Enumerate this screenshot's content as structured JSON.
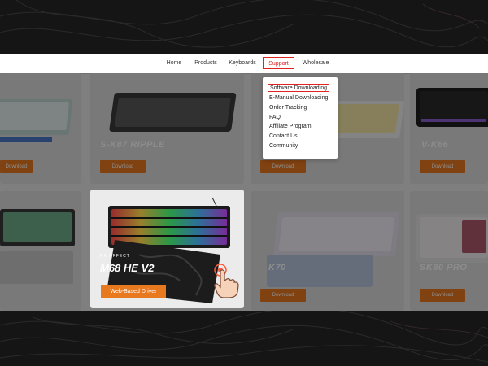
{
  "colors": {
    "accent_red": "#e02222",
    "download_orange": "#e9791f",
    "page_bg": "#151515"
  },
  "nav": {
    "items": [
      {
        "label": "Home",
        "active": false
      },
      {
        "label": "Products",
        "active": false
      },
      {
        "label": "Keyboards",
        "active": false
      },
      {
        "label": "Support",
        "active": true
      },
      {
        "label": "Wholesale",
        "active": false
      }
    ]
  },
  "support_menu": {
    "items": [
      {
        "label": "Software Downloading",
        "active": true
      },
      {
        "label": "E-Manual Downloading",
        "active": false
      },
      {
        "label": "Order Tracking",
        "active": false
      },
      {
        "label": "FAQ",
        "active": false
      },
      {
        "label": "Affiliate Program",
        "active": false
      },
      {
        "label": "Contact Us",
        "active": false
      },
      {
        "label": "Community",
        "active": false
      }
    ]
  },
  "products": {
    "row1": [
      {
        "name": "",
        "button": "Download"
      },
      {
        "name": "S-K87 RIPPLE",
        "button": "Download"
      },
      {
        "name": "",
        "button": "Download"
      },
      {
        "name": "V-K66",
        "button": "Download"
      }
    ],
    "row2": [
      {
        "name": "",
        "button": ""
      },
      {
        "name": "",
        "button": ""
      },
      {
        "name": "K70",
        "button": "Download"
      },
      {
        "name": "SK80 PRO",
        "button": "Download"
      }
    ]
  },
  "featured": {
    "brand": "RK EFFECT",
    "title": "M68 HE V2",
    "button": "Web-Based Driver",
    "click_icon": "hand-pointer-icon"
  }
}
